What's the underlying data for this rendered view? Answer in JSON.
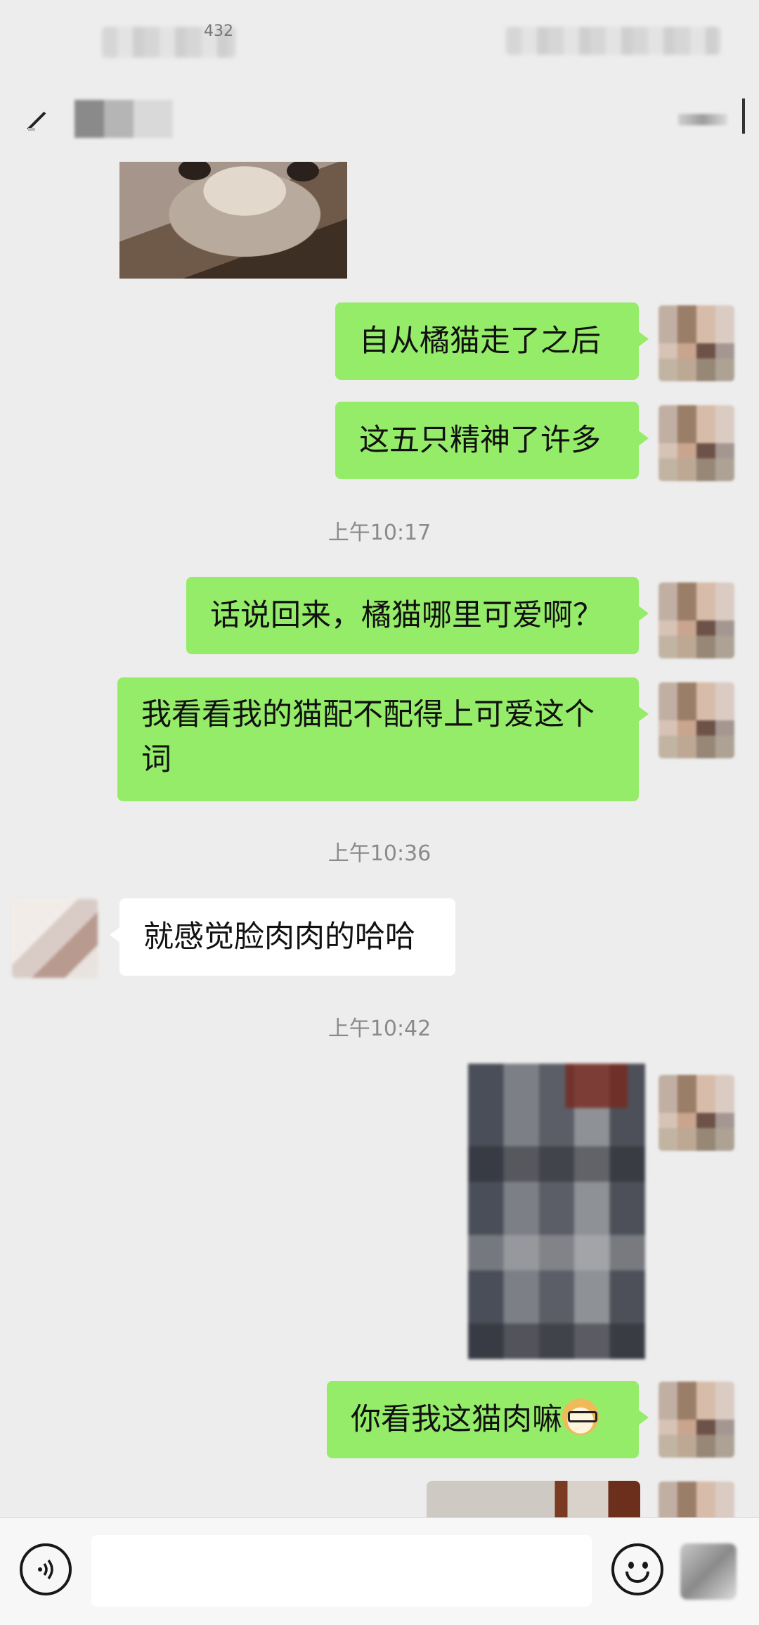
{
  "status_bar": {
    "number": "432"
  },
  "messages": [
    {
      "kind": "text",
      "side": "me",
      "text": "自从橘猫走了之后"
    },
    {
      "kind": "text",
      "side": "me",
      "text": "这五只精神了许多"
    },
    {
      "kind": "time",
      "text": "上午10:17"
    },
    {
      "kind": "text",
      "side": "me",
      "text": "话说回来，橘猫哪里可爱啊？"
    },
    {
      "kind": "text",
      "side": "me",
      "text": "我看看我的猫配不配得上可爱这个词"
    },
    {
      "kind": "time",
      "text": "上午10:36"
    },
    {
      "kind": "text",
      "side": "other",
      "text": "就感觉脸肉肉的哈哈"
    },
    {
      "kind": "time",
      "text": "上午10:42"
    },
    {
      "kind": "text",
      "side": "me",
      "text": "你看我这猫肉嘛",
      "emoji": "doge-emoji"
    }
  ],
  "input_bar": {
    "placeholder": ""
  },
  "icons": {
    "back": "back-arrow-icon",
    "voice": "voice-icon",
    "emoji": "smiley-icon",
    "more": "more-icon"
  },
  "colors": {
    "my_bubble": "#95ec69",
    "other_bubble": "#ffffff",
    "background": "#ededed"
  }
}
